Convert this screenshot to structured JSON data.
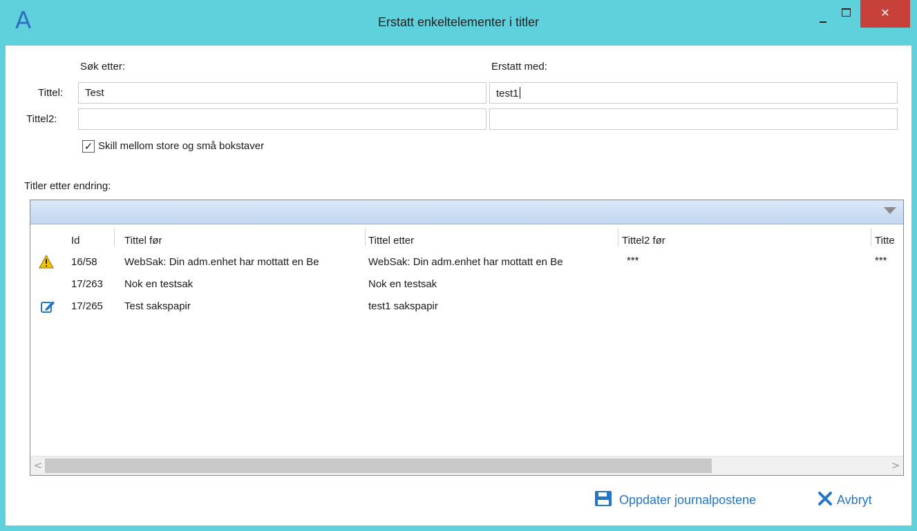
{
  "window": {
    "logo": "A",
    "title": "Erstatt enkeltelementer i titler",
    "close_glyph": "✕"
  },
  "form": {
    "search_header": "Søk etter:",
    "replace_header": "Erstatt med:",
    "rows": [
      {
        "label": "Tittel:",
        "search_value": "Test",
        "replace_value": "test1"
      },
      {
        "label": "Tittel2:",
        "search_value": "",
        "replace_value": ""
      }
    ],
    "case_checkbox": {
      "label": "Skill mellom store og små bokstaver",
      "checked": true,
      "mark": "✓"
    }
  },
  "grid": {
    "section_label": "Titler etter endring:",
    "columns": [
      "Id",
      "Tittel før",
      "Tittel etter",
      "Tittel2 før",
      "Titte"
    ],
    "rows": [
      {
        "icon": "warning-icon",
        "id": "16/58",
        "before": "WebSak: Din adm.enhet har mottatt en Be",
        "after": "WebSak: Din adm.enhet har mottatt en Be",
        "t2before": "***",
        "t2after": "***"
      },
      {
        "icon": "",
        "id": "17/263",
        "before": "Nok en testsak",
        "after": "Nok en testsak",
        "t2before": "",
        "t2after": ""
      },
      {
        "icon": "edit-icon",
        "id": "17/265",
        "before": "Test sakspapir",
        "after": "test1 sakspapir",
        "t2before": "",
        "t2after": ""
      }
    ],
    "scroll_left": "<",
    "scroll_right": ">"
  },
  "footer": {
    "update_label": "Oppdater journalpostene",
    "cancel_label": "Avbryt"
  },
  "colors": {
    "titlebar": "#5ed1dc",
    "close": "#c8403a",
    "accent": "#2476c7",
    "warning": "#f5c400"
  }
}
